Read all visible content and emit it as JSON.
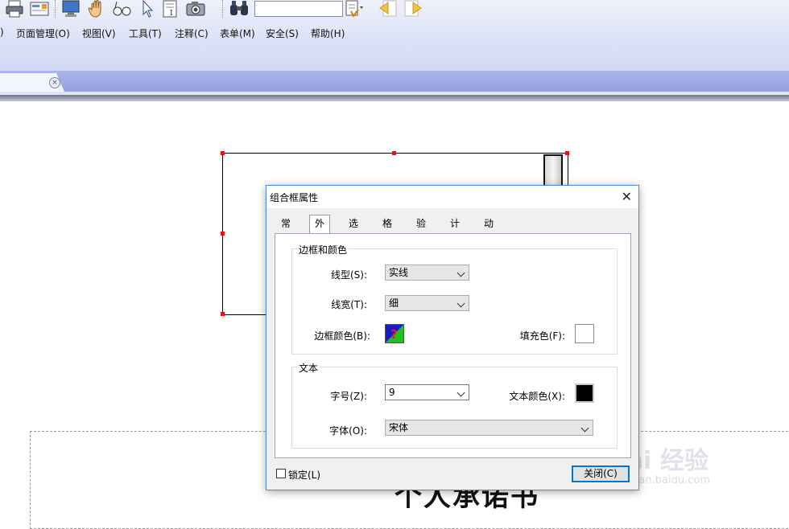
{
  "toolbar": {
    "search_value": "",
    "icons": [
      "printer-icon",
      "email-icon",
      "monitor-icon",
      "hand-icon",
      "glasses-icon",
      "cursor-icon",
      "text-select-icon",
      "camera-icon",
      "binoculars-icon",
      "spellcheck-icon",
      "back-icon",
      "forward-icon"
    ]
  },
  "menubar": {
    "items": [
      {
        "label": ")"
      },
      {
        "label": "页面管理(O)"
      },
      {
        "label": "视图(V)"
      },
      {
        "label": "工具(T)"
      },
      {
        "label": "注释(C)"
      },
      {
        "label": "表单(M)"
      },
      {
        "label": "安全(S)"
      },
      {
        "label": "帮助(H)"
      }
    ]
  },
  "tab": {
    "close_glyph": "×"
  },
  "document": {
    "heading": "个人承诺书"
  },
  "watermark": {
    "big": "Bai 经验",
    "small": "jingyan.baidu.com"
  },
  "dialog": {
    "title": "组合框属性",
    "close_glyph": "✕",
    "tabs": [
      {
        "label": "常规"
      },
      {
        "label": "外观",
        "active": true
      },
      {
        "label": "选项"
      },
      {
        "label": "格式"
      },
      {
        "label": "验证"
      },
      {
        "label": "计算"
      },
      {
        "label": "动作"
      }
    ],
    "border_group": {
      "title": "边框和颜色",
      "line_type_label": "线型(S):",
      "line_type_value": "实线",
      "line_width_label": "线宽(T):",
      "line_width_value": "细",
      "border_color_label": "边框颜色(B):",
      "fill_color_label": "填充色(F):",
      "fill_color": "#ffffff"
    },
    "text_group": {
      "title": "文本",
      "font_size_label": "字号(Z):",
      "font_size_value": "9",
      "text_color_label": "文本颜色(X):",
      "text_color": "#000000",
      "font_label": "字体(O):",
      "font_value": "宋体"
    },
    "lock_label": "锁定(L)",
    "lock_checked": false,
    "close_button": "关闭(C)"
  },
  "colors": {
    "accent": "#0078d7",
    "handle": "#e31414",
    "tabstrip": "#93a2df"
  }
}
